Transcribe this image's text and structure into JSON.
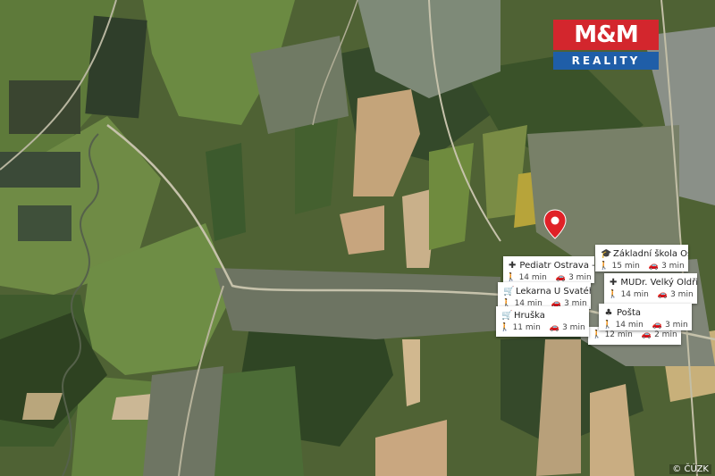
{
  "brand": {
    "top": "M&M",
    "bottom": "REALITY"
  },
  "copyright": "© ČÚZK",
  "colors": {
    "logo_red": "#d3262d",
    "logo_blue": "#1f5ea8",
    "pin": "#e02127"
  },
  "pois": [
    {
      "icon": "school-icon",
      "name": "Základní škola Os...",
      "walk": "15 min",
      "car": "3 min"
    },
    {
      "icon": "medical-icon",
      "name": "Pediatr Ostrava - ...",
      "walk": "14 min",
      "car": "3 min"
    },
    {
      "icon": "medical-icon",
      "name": "MUDr. Velký Oldři...",
      "walk": "14 min",
      "car": "3 min"
    },
    {
      "icon": "cart-icon",
      "name": "Lekarna U Svatéh...",
      "walk": "14 min",
      "car": "3 min"
    },
    {
      "icon": "post-icon",
      "name": "Pošta",
      "walk": "14 min",
      "car": "3 min"
    },
    {
      "icon": "cart-icon",
      "name": "Hruška",
      "walk": "11 min",
      "car": "3 min"
    },
    {
      "icon": "school-icon",
      "name": "",
      "walk": "12 min",
      "car": "2 min"
    }
  ]
}
